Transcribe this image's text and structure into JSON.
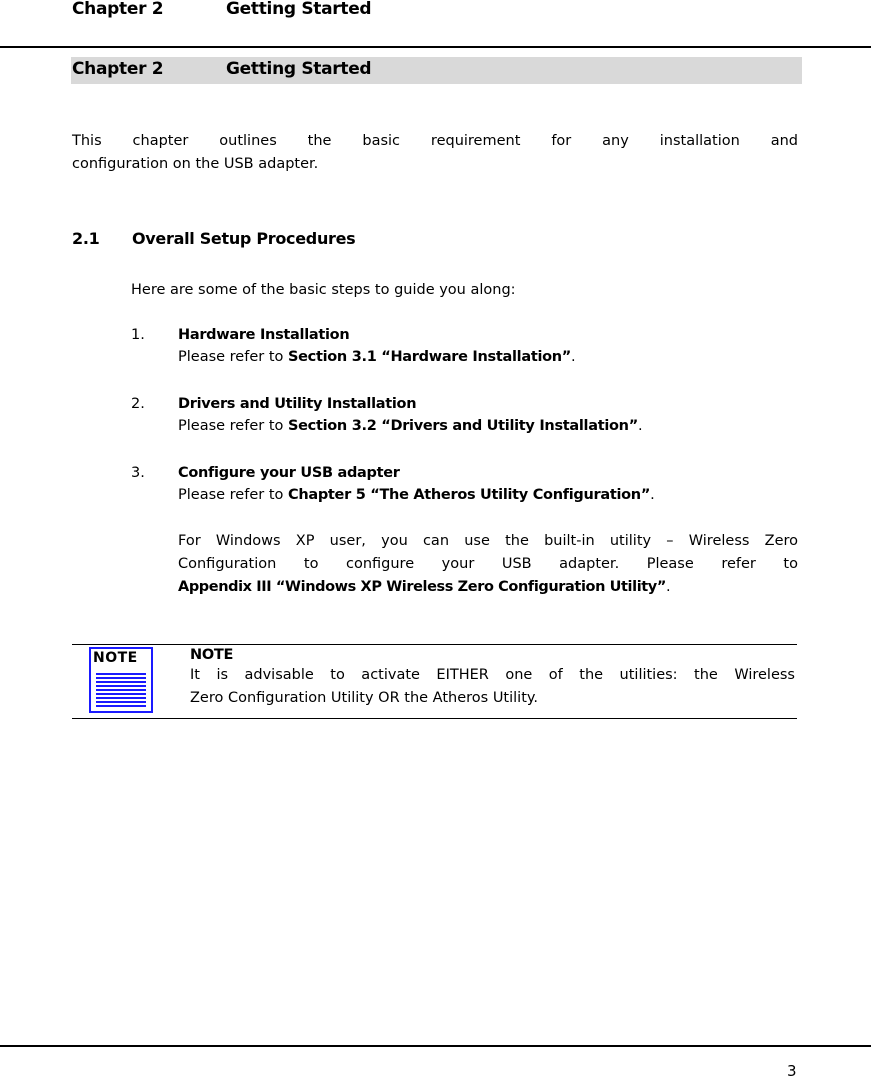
{
  "running_header": {
    "chapter": "Chapter 2",
    "title": "Getting Started"
  },
  "chapter_heading": {
    "chapter": "Chapter 2",
    "title": "Getting Started"
  },
  "intro": {
    "line1": "This chapter outlines the basic requirement for any installation and",
    "line2": "configuration on the USB adapter."
  },
  "section": {
    "number": "2.1",
    "title": "Overall Setup Procedures"
  },
  "lead": "Here are some of the basic steps to guide you along:",
  "steps": [
    {
      "number": "1.",
      "title": "Hardware Installation",
      "refer_prefix": "Please refer to ",
      "refer_bold": "Section 3.1 “Hardware Installation”",
      "refer_suffix": "."
    },
    {
      "number": "2.",
      "title": "Drivers and Utility Installation",
      "refer_prefix": "Please refer to ",
      "refer_bold": "Section 3.2 “Drivers and Utility Installation”",
      "refer_suffix": "."
    },
    {
      "number": "3.",
      "title": "Configure your USB adapter",
      "refer_prefix": "Please refer to ",
      "refer_bold": "Chapter 5 “The Atheros Utility Configuration”",
      "refer_suffix": "."
    }
  ],
  "xp_note": {
    "line1": "For Windows XP user, you can use the built-in utility – Wireless Zero",
    "line2": "Configuration to configure your USB adapter. Please refer to",
    "line3_bold": "Appendix III “Windows XP Wireless Zero Configuration Utility”",
    "line3_suffix": "."
  },
  "note": {
    "icon_label": "NOTE",
    "label": "NOTE",
    "line1": "It is advisable to activate EITHER one of the utilities: the Wireless",
    "line2": "Zero Configuration Utility OR the Atheros Utility."
  },
  "footer": {
    "page_number": "3"
  },
  "colors": {
    "note_icon_blue": "#1a1aff",
    "chapter_band": "#d9d9d9"
  }
}
